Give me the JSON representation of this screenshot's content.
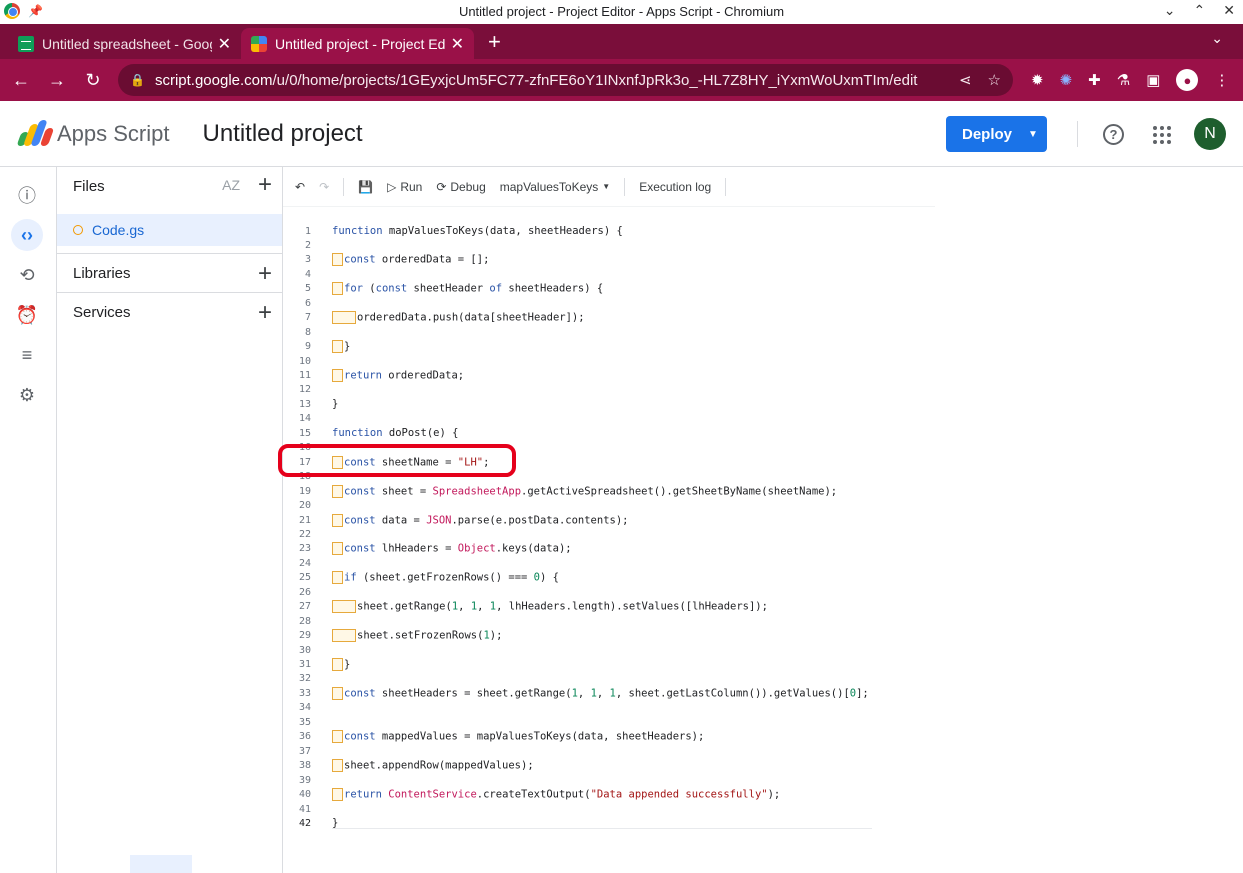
{
  "window": {
    "title": "Untitled project - Project Editor - Apps Script - Chromium"
  },
  "tabs": [
    {
      "label": "Untitled spreadsheet - Goog",
      "favicon": "sheets-icon",
      "active": false
    },
    {
      "label": "Untitled project - Project Edit",
      "favicon": "apps-script-icon",
      "active": true
    }
  ],
  "omnibox": {
    "url_host": "script.google.com",
    "url_path": "/u/0/home/projects/1GEyxjcUm5FC77-zfnFE6oY1INxnfJpRk3o_-HL7Z8HY_iYxmWoUxmTIm/edit"
  },
  "header": {
    "app_name": "Apps Script",
    "project_name": "Untitled project",
    "deploy_label": "Deploy",
    "avatar_letter": "N",
    "help_glyph": "?"
  },
  "files_panel": {
    "title": "Files",
    "sort_label": "AZ",
    "file": "Code.gs",
    "libraries": "Libraries",
    "services": "Services"
  },
  "editor_toolbar": {
    "run": "Run",
    "debug": "Debug",
    "function": "mapValuesToKeys",
    "execution_log": "Execution log"
  },
  "colors": {
    "chrome_frame": "#7a0e3a",
    "chrome_toolbar": "#9a1148",
    "deploy": "#1a73e8",
    "highlight": "#e5001b"
  },
  "code_lines": [
    {
      "n": "1",
      "html": "<span class=\"kw\">function</span> mapValuesToKeys(data, sheetHeaders) {"
    },
    {
      "n": "2",
      "html": ""
    },
    {
      "n": "3",
      "html": "<i class=\"ind\"></i><span class=\"kw\">const</span> orderedData = [];"
    },
    {
      "n": "4",
      "html": ""
    },
    {
      "n": "5",
      "html": "<i class=\"ind\"></i><span class=\"kw\">for</span> (<span class=\"kw\">const</span> sheetHeader <span class=\"kw\">of</span> sheetHeaders) {"
    },
    {
      "n": "6",
      "html": ""
    },
    {
      "n": "7",
      "html": "<i class=\"ind w2\"></i>orderedData.push(data[sheetHeader]);"
    },
    {
      "n": "8",
      "html": ""
    },
    {
      "n": "9",
      "html": "<i class=\"ind\"></i>}"
    },
    {
      "n": "10",
      "html": ""
    },
    {
      "n": "11",
      "html": "<i class=\"ind\"></i><span class=\"kw\">return</span> orderedData;"
    },
    {
      "n": "12",
      "html": ""
    },
    {
      "n": "13",
      "html": "}"
    },
    {
      "n": "14",
      "html": ""
    },
    {
      "n": "15",
      "html": "<span class=\"kw\">function</span> doPost(e) {"
    },
    {
      "n": "16",
      "html": ""
    },
    {
      "n": "17",
      "html": "<i class=\"ind\"></i><span class=\"kw\">const</span> sheetName = <span class=\"str\">\"LH\"</span>;"
    },
    {
      "n": "18",
      "html": ""
    },
    {
      "n": "19",
      "html": "<i class=\"ind\"></i><span class=\"kw\">const</span> sheet = <span class=\"cls\">SpreadsheetApp</span>.getActiveSpreadsheet().getSheetByName(sheetName);"
    },
    {
      "n": "20",
      "html": ""
    },
    {
      "n": "21",
      "html": "<i class=\"ind\"></i><span class=\"kw\">const</span> data = <span class=\"cls\">JSON</span>.parse(e.postData.contents);"
    },
    {
      "n": "22",
      "html": ""
    },
    {
      "n": "23",
      "html": "<i class=\"ind\"></i><span class=\"kw\">const</span> lhHeaders = <span class=\"cls\">Object</span>.keys(data);"
    },
    {
      "n": "24",
      "html": ""
    },
    {
      "n": "25",
      "html": "<i class=\"ind\"></i><span class=\"kw\">if</span> (sheet.getFrozenRows() === <span class=\"num\">0</span>) {"
    },
    {
      "n": "26",
      "html": ""
    },
    {
      "n": "27",
      "html": "<i class=\"ind w2\"></i>sheet.getRange(<span class=\"num\">1</span>, <span class=\"num\">1</span>, <span class=\"num\">1</span>, lhHeaders.length).setValues([lhHeaders]);"
    },
    {
      "n": "28",
      "html": ""
    },
    {
      "n": "29",
      "html": "<i class=\"ind w2\"></i>sheet.setFrozenRows(<span class=\"num\">1</span>);"
    },
    {
      "n": "30",
      "html": ""
    },
    {
      "n": "31",
      "html": "<i class=\"ind\"></i>}"
    },
    {
      "n": "32",
      "html": ""
    },
    {
      "n": "33",
      "html": "<i class=\"ind\"></i><span class=\"kw\">const</span> sheetHeaders = sheet.getRange(<span class=\"num\">1</span>, <span class=\"num\">1</span>, <span class=\"num\">1</span>, sheet.getLastColumn()).getValues()[<span class=\"num\">0</span>];"
    },
    {
      "n": "34",
      "html": ""
    },
    {
      "n": "35",
      "html": ""
    },
    {
      "n": "36",
      "html": "<i class=\"ind\"></i><span class=\"kw\">const</span> mappedValues = mapValuesToKeys(data, sheetHeaders);"
    },
    {
      "n": "37",
      "html": ""
    },
    {
      "n": "38",
      "html": "<i class=\"ind\"></i>sheet.appendRow(mappedValues);"
    },
    {
      "n": "39",
      "html": ""
    },
    {
      "n": "40",
      "html": "<i class=\"ind\"></i><span class=\"kw\">return</span> <span class=\"cls\">ContentService</span>.createTextOutput(<span class=\"str\">\"Data appended successfully\"</span>);"
    },
    {
      "n": "41",
      "html": ""
    },
    {
      "n": "42",
      "html": "}"
    }
  ]
}
